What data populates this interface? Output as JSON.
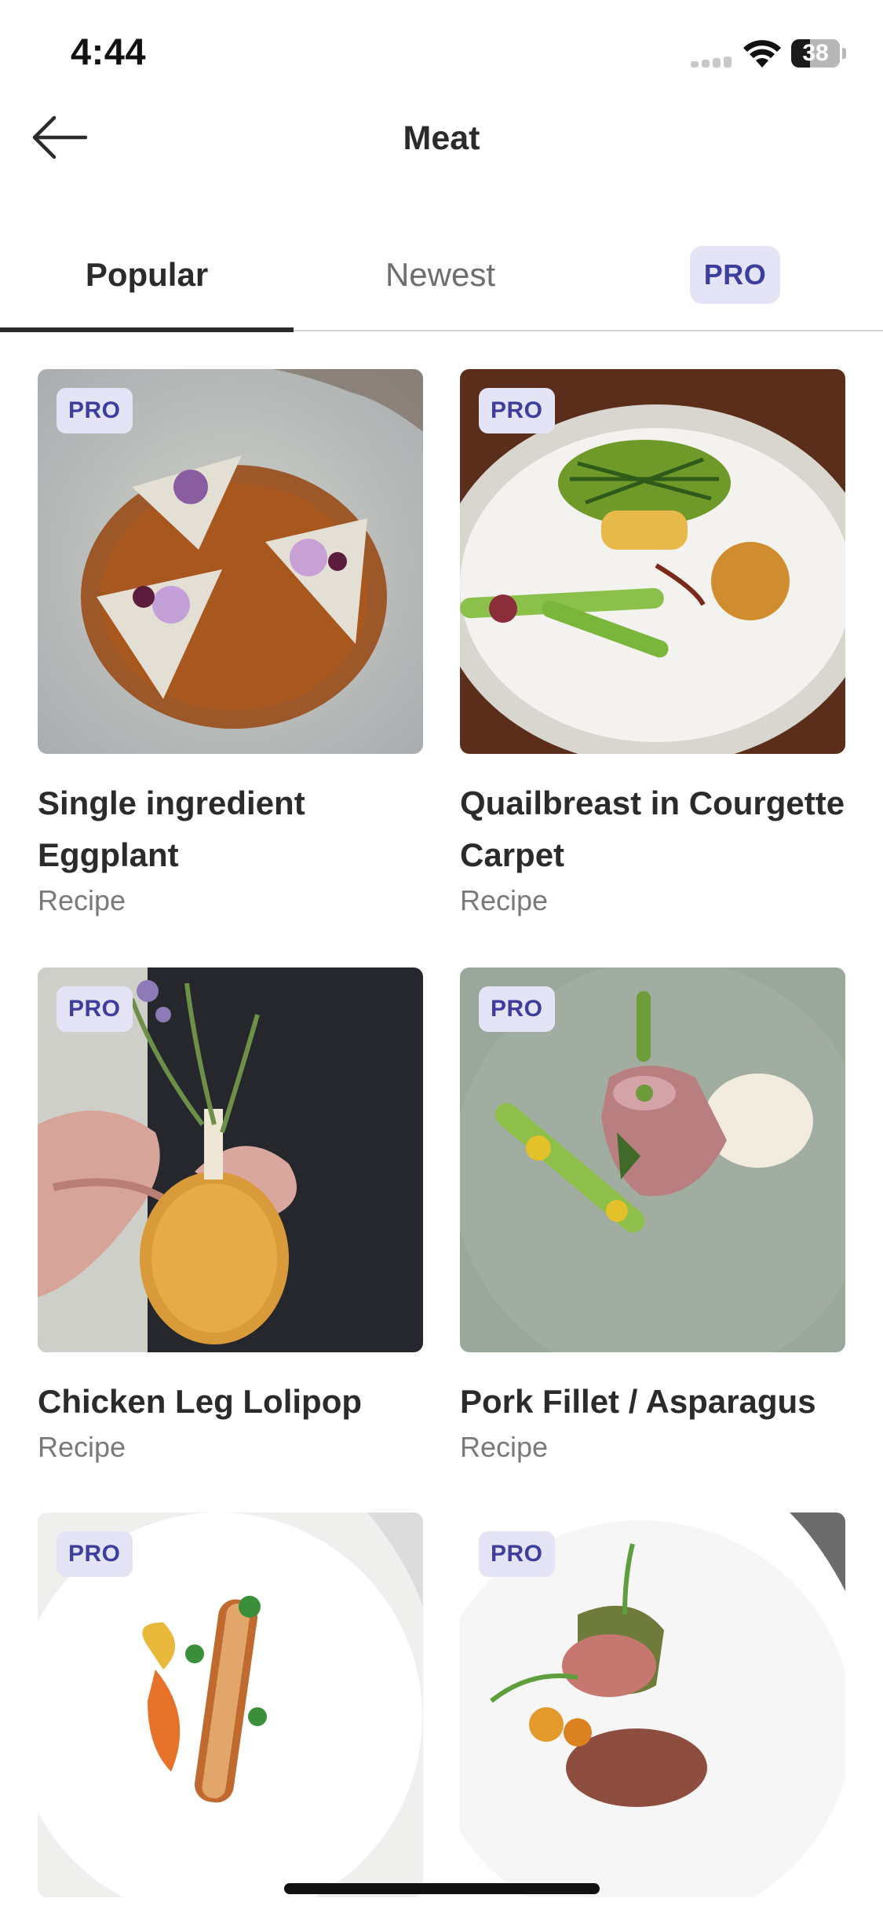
{
  "status_bar": {
    "time": "4:44",
    "battery": "38",
    "battery_level": 0.38
  },
  "header": {
    "title": "Meat"
  },
  "tabs": [
    {
      "label": "Popular",
      "active": true
    },
    {
      "label": "Newest",
      "active": false
    },
    {
      "label": "PRO",
      "active": false
    }
  ],
  "recipes": [
    {
      "badge": "PRO",
      "title": "Single ingredient Eggplant",
      "type": "Recipe"
    },
    {
      "badge": "PRO",
      "title": "Quailbreast in Courgette Carpet",
      "type": "Recipe"
    },
    {
      "badge": "PRO",
      "title": "Chicken Leg Lolipop",
      "type": "Recipe"
    },
    {
      "badge": "PRO",
      "title": "Pork Fillet / Asparagus",
      "type": "Recipe"
    },
    {
      "badge": "PRO",
      "title": "",
      "type": ""
    },
    {
      "badge": "PRO",
      "title": "",
      "type": ""
    }
  ],
  "colors": {
    "pro_badge_bg": "#e4e4f6",
    "pro_badge_text": "#3d3e9e",
    "accent_indicator": "#2b2b2b"
  }
}
